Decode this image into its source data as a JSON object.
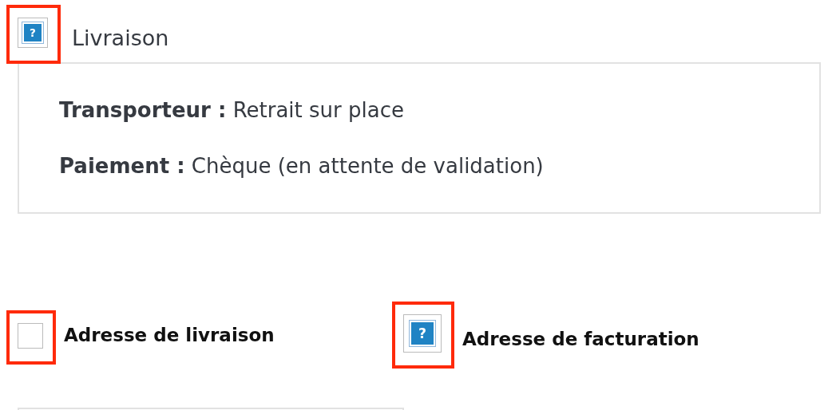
{
  "delivery": {
    "icon": {
      "kind": "missing",
      "label": "?",
      "highlighted": true
    },
    "title": "Livraison",
    "lines": [
      {
        "label": "Transporteur :",
        "value": "Retrait sur place"
      },
      {
        "label": "Paiement :",
        "value": "Chèque (en attente de validation)"
      }
    ]
  },
  "addresses": [
    {
      "icon": {
        "kind": "blank",
        "highlighted": true
      },
      "title": "Adresse de livraison"
    },
    {
      "icon": {
        "kind": "missing",
        "label": "?",
        "highlighted": true
      },
      "title": "Adresse de facturation"
    }
  ]
}
